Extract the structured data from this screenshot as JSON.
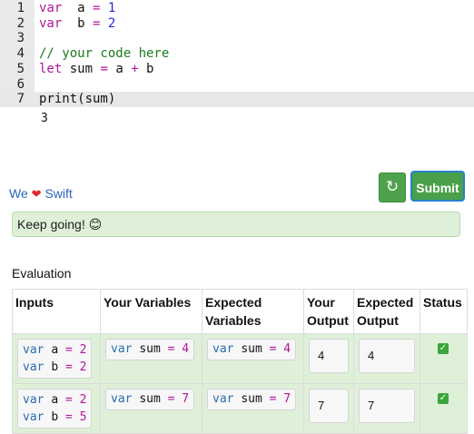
{
  "editor": {
    "lines": [
      {
        "n": "1",
        "tokens": [
          [
            "kw",
            "var"
          ],
          [
            "",
            "  a "
          ],
          [
            "op",
            "="
          ],
          [
            "num",
            " 1"
          ]
        ]
      },
      {
        "n": "2",
        "tokens": [
          [
            "kw",
            "var"
          ],
          [
            "",
            "  b "
          ],
          [
            "op",
            "="
          ],
          [
            "num",
            " 2"
          ]
        ]
      },
      {
        "n": "3",
        "tokens": []
      },
      {
        "n": "4",
        "tokens": [
          [
            "cm",
            "// your code here"
          ]
        ]
      },
      {
        "n": "5",
        "tokens": [
          [
            "kw",
            "let"
          ],
          [
            "",
            " sum "
          ],
          [
            "op",
            "="
          ],
          [
            "",
            " a "
          ],
          [
            "op",
            "+"
          ],
          [
            "",
            " b"
          ]
        ]
      },
      {
        "n": "6",
        "tokens": []
      },
      {
        "n": "7",
        "tokens": [
          [
            "",
            "print(sum)"
          ]
        ]
      }
    ],
    "output": "3"
  },
  "footer": {
    "brand_we": "We",
    "brand_heart": "❤",
    "brand_swift": "Swift",
    "refresh_icon": "↻",
    "submit_label": "Submit"
  },
  "alert": {
    "text": "Keep going! 😊"
  },
  "evaluation": {
    "title": "Evaluation",
    "headers": {
      "inputs": "Inputs",
      "your_variables": "Your Variables",
      "expected_variables_1": "Expected",
      "expected_variables_2": "Variables",
      "your_output_1": "Your",
      "your_output_2": "Output",
      "expected_output_1": "Expected",
      "expected_output_2": "Output",
      "status": "Status"
    },
    "rows": [
      {
        "in1_kw": "var",
        "in1_name": "a",
        "in1_op": "=",
        "in1_val": "2",
        "in2_kw": "var",
        "in2_name": "b",
        "in2_op": "=",
        "in2_val": "2",
        "yv_kw": "var",
        "yv_name": "sum",
        "yv_op": "=",
        "yv_val": "4",
        "ev_kw": "var",
        "ev_name": "sum",
        "ev_op": "=",
        "ev_val": "4",
        "your_output": "4",
        "expected_output": "4",
        "status": "✓"
      },
      {
        "in1_kw": "var",
        "in1_name": "a",
        "in1_op": "=",
        "in1_val": "2",
        "in2_kw": "var",
        "in2_name": "b",
        "in2_op": "=",
        "in2_val": "5",
        "yv_kw": "var",
        "yv_name": "sum",
        "yv_op": "=",
        "yv_val": "7",
        "ev_kw": "var",
        "ev_name": "sum",
        "ev_op": "=",
        "ev_val": "7",
        "your_output": "7",
        "expected_output": "7",
        "status": "✓"
      }
    ]
  }
}
